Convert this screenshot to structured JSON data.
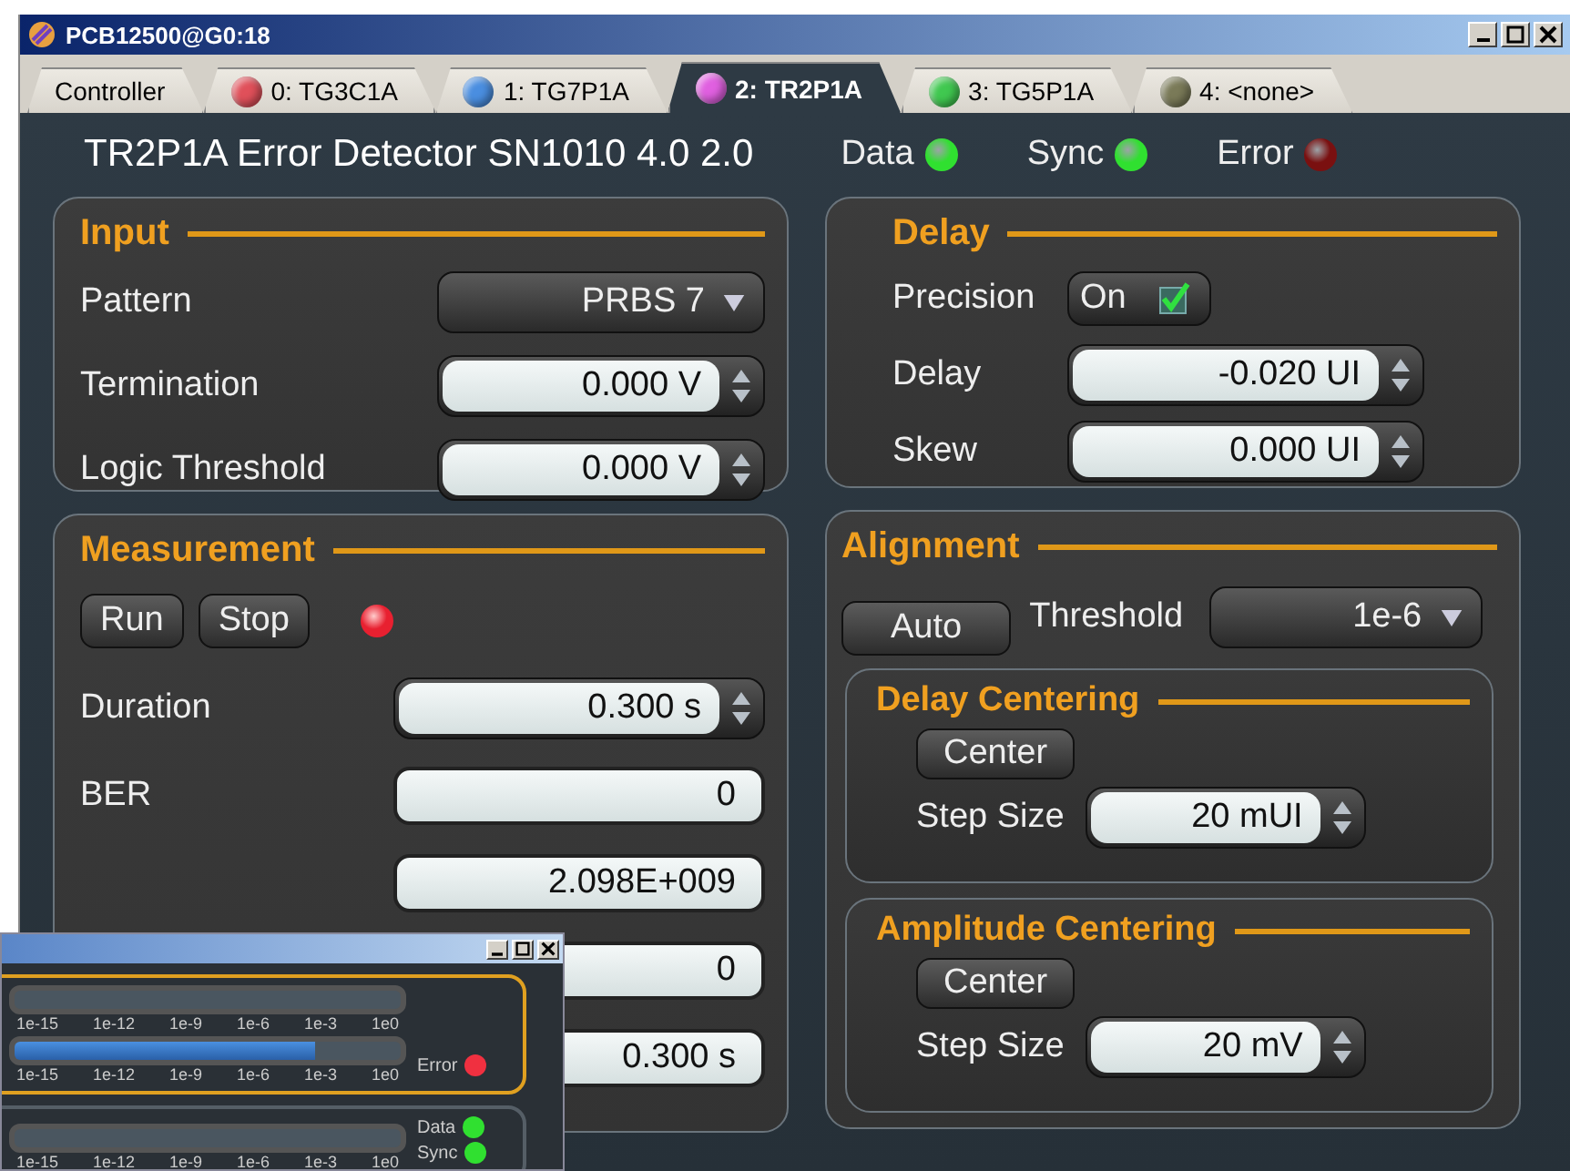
{
  "window": {
    "title": "PCB12500@G0:18"
  },
  "tabs": [
    {
      "label": "Controller",
      "selected": false
    },
    {
      "label": "0: TG3C1A",
      "color": "#e0505a",
      "selected": false
    },
    {
      "label": "1: TG7P1A",
      "color": "#4a8ee0",
      "selected": false
    },
    {
      "label": "2: TR2P1A",
      "color": "#e060e0",
      "selected": true
    },
    {
      "label": "3: TG5P1A",
      "color": "#40c850",
      "selected": false
    },
    {
      "label": "4: <none>",
      "color": "#7a7a58",
      "selected": false
    }
  ],
  "header": {
    "title": "TR2P1A Error Detector SN1010 4.0 2.0",
    "indicators": [
      {
        "label": "Data",
        "color": "#30e030"
      },
      {
        "label": "Sync",
        "color": "#30e030"
      },
      {
        "label": "Error",
        "color": "#7a1010"
      }
    ]
  },
  "input": {
    "title": "Input",
    "rows": [
      {
        "kind": "dropdown",
        "label": "Pattern",
        "value": "PRBS 7"
      },
      {
        "kind": "spinner",
        "label": "Termination",
        "value": "0.000 V"
      },
      {
        "kind": "spinner",
        "label": "Logic Threshold",
        "value": "0.000 V"
      }
    ]
  },
  "measurement": {
    "title": "Measurement",
    "buttons": [
      "Run",
      "Stop"
    ],
    "status_led": {
      "on": true
    },
    "rows": [
      {
        "kind": "spinner",
        "label": "Duration",
        "value": "0.300 s"
      },
      {
        "kind": "display",
        "label": "BER",
        "value": "0"
      },
      {
        "kind": "display",
        "value": "2.098E+009"
      },
      {
        "kind": "display",
        "value": "0"
      },
      {
        "kind": "display",
        "value": "0.300 s"
      }
    ]
  },
  "delay": {
    "title": "Delay",
    "precision": {
      "label": "Precision",
      "value": "On",
      "checked": true
    },
    "rows": [
      {
        "kind": "spinner",
        "label": "Delay",
        "value": "-0.020 UI"
      },
      {
        "kind": "spinner",
        "label": "Skew",
        "value": "0.000 UI"
      }
    ]
  },
  "alignment": {
    "title": "Alignment",
    "button": "Auto",
    "threshold": {
      "label": "Threshold",
      "value": "1e-6"
    },
    "sections": [
      {
        "title": "Delay Centering",
        "button": "Center",
        "step_label": "Step Size",
        "step_value": "20 mUI"
      },
      {
        "title": "Amplitude Centering",
        "button": "Center",
        "step_label": "Step Size",
        "step_value": "20 mV"
      }
    ]
  },
  "overlay_window": {
    "panels": [
      {
        "highlighted": true,
        "meters": [
          {
            "ticks": [
              "1e-15",
              "1e-12",
              "1e-9",
              "1e-6",
              "1e-3",
              "1e0"
            ]
          },
          {
            "level": 0.78,
            "ticks": [
              "1e-15",
              "1e-12",
              "1e-9",
              "1e-6",
              "1e-3",
              "1e0"
            ]
          }
        ],
        "indicators": [
          {
            "label": "Error",
            "color": "#f03040"
          }
        ]
      },
      {
        "highlighted": false,
        "meters": [
          {
            "ticks": [
              "1e-15",
              "1e-12",
              "1e-9",
              "1e-6",
              "1e-3",
              "1e0"
            ]
          }
        ],
        "indicators": [
          {
            "label": "Data",
            "color": "#30e030"
          },
          {
            "label": "Sync",
            "color": "#30e030"
          }
        ]
      }
    ]
  }
}
